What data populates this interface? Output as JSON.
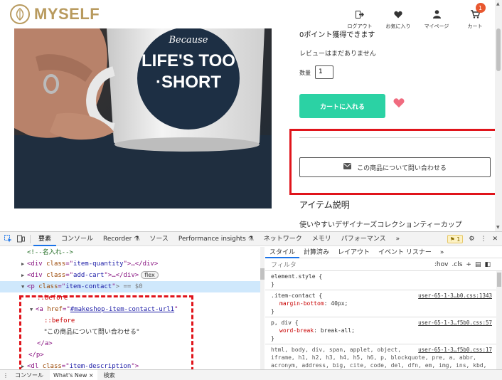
{
  "header": {
    "logo_text": "MYSELF",
    "brand_color": "#b89a5e",
    "icons": [
      {
        "label": "ログアウト",
        "icon": "logout-icon"
      },
      {
        "label": "お気に入り",
        "icon": "heart-icon"
      },
      {
        "label": "マイページ",
        "icon": "user-icon"
      },
      {
        "label": "カート",
        "icon": "cart-icon"
      }
    ],
    "cart_count": "1"
  },
  "product": {
    "mug_text": {
      "line1": "Because",
      "line2": "LIFE'S TOO",
      "line3": "·SHORT"
    },
    "points_text": "0ポイント獲得できます",
    "review_text": "レビューはまだありません",
    "qty_label": "数量",
    "qty_value": "1",
    "add_to_cart_label": "カートに入れる",
    "add_to_cart_color": "#2bd2a4",
    "contact_label": "この商品について問い合わせる",
    "item_title": "アイテム説明",
    "item_desc": "使いやすいデザイナーズコレクションティーカップ",
    "highlight_color": "#e0141b"
  },
  "devtools": {
    "tabs": [
      "要素",
      "コンソール",
      "Recorder",
      "ソース",
      "Performance insights",
      "ネットワーク",
      "メモリ",
      "パフォーマンス",
      "»"
    ],
    "active_tab": "要素",
    "issues_count": "1",
    "elements": {
      "comment": "<!--名入れ-->",
      "line_quantity": {
        "tag": "div",
        "attr": "class",
        "val": "item-quantity",
        "tail": ">…</div>"
      },
      "line_addcart": {
        "tag": "div",
        "attr": "class",
        "val": "add-cart",
        "tail": ">…</div>",
        "badge": "flex"
      },
      "line_contact": {
        "tag": "p",
        "attr": "class",
        "val": "item-contact",
        "tail": "> == $0"
      },
      "before1": "::before",
      "line_anchor": {
        "tag": "a",
        "attr": "href",
        "val": "#makeshop-item-contact-url1"
      },
      "before2": "::before",
      "text_node": "\"この商品について問い合わせる\"",
      "close_a": "</a>",
      "close_p": "</p>",
      "line_desc": {
        "tag": "dl",
        "attr": "class",
        "val": "item-description"
      }
    },
    "styles": {
      "tabs": [
        "スタイル",
        "計算済み",
        "レイアウト",
        "イベント リスナー",
        "»"
      ],
      "filter_placeholder": "フィルタ",
      "filter_tools": [
        ":hov",
        ".cls",
        "+"
      ],
      "rules": [
        {
          "selector": "element.style {",
          "source": "",
          "props": [],
          "close": "}"
        },
        {
          "selector": ".item-contact {",
          "source": "user-65-1-3…b0.css:1343",
          "props": [
            {
              "name": "margin-bottom",
              "value": "40px;"
            }
          ],
          "close": "}"
        },
        {
          "selector": "p, div {",
          "source": "user-65-1-3…f5b0.css:57",
          "props": [
            {
              "name": "word-break",
              "value": "break-all;"
            }
          ],
          "close": "}"
        },
        {
          "selector": "html, body, div, span, applet, object,",
          "source": "user-65-1-3…f5b0.css:17",
          "props": [],
          "close": "iframe, h1, h2, h3, h4, h5, h6, p, blockquote, pre, a, abbr, acronym, address, big, cite, code, del, dfn, em, img, ins, kbd, q, s, samp, small, strike, strong, sub, sup, tt, var, b, u, i, center, dl, dt, dd,"
        }
      ]
    },
    "drawer_tabs": [
      "コンソール",
      "What's New ×",
      "検索"
    ]
  }
}
